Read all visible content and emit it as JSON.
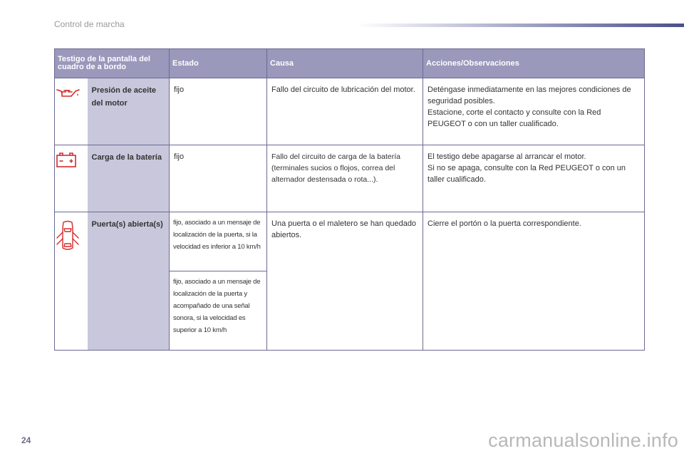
{
  "header": {
    "section_title": "Control de marcha"
  },
  "table": {
    "columns": [
      "Testigo de la pantalla del cuadro de a bordo",
      "Estado",
      "Causa",
      "Acciones/Observaciones"
    ],
    "rows": [
      {
        "icon": "oil-can-icon",
        "name": "Presión de aceite del motor",
        "estado": "fijo",
        "causa": "Fallo del circuito de lubricación del motor.",
        "acciones": [
          "Deténgase inmediatamente en las mejores condiciones de seguridad posibles.",
          "Estacione, corte el contacto y consulte con la Red PEUGEOT o con un taller cualificado."
        ]
      },
      {
        "icon": "battery-icon",
        "name": "Carga de la batería",
        "estado": "fijo",
        "causa": "Fallo del circuito de carga de la batería (terminales sucios o flojos, correa del alternador destensada o rota...).",
        "acciones": [
          "El testigo debe apagarse al arrancar el motor.",
          "Si no se apaga, consulte con la Red PEUGEOT o con un taller cualificado."
        ]
      },
      {
        "icon": "car-doors-open-icon",
        "name": "Puerta(s) abierta(s)",
        "estado_a": "fijo, asociado a un mensaje de localización de la puerta, si la velocidad es inferior a 10 km/h",
        "estado_b": "fijo, asociado a un mensaje de localización de la puerta y acompañado de una señal sonora, si la velocidad es superior a 10 km/h",
        "causa": "Una puerta o el maletero se han quedado abiertos.",
        "acciones": [
          "Cierre el portón o la puerta correspondiente."
        ]
      }
    ]
  },
  "footer": {
    "page_number": "24",
    "watermark": "carmanualsonline.info"
  },
  "colors": {
    "header_fill": "#9a98bb",
    "name_fill": "#c8c7dc",
    "border": "#6b6a92",
    "warning_red": "#d32b2b",
    "accent_bar": "#4b4f8c"
  }
}
